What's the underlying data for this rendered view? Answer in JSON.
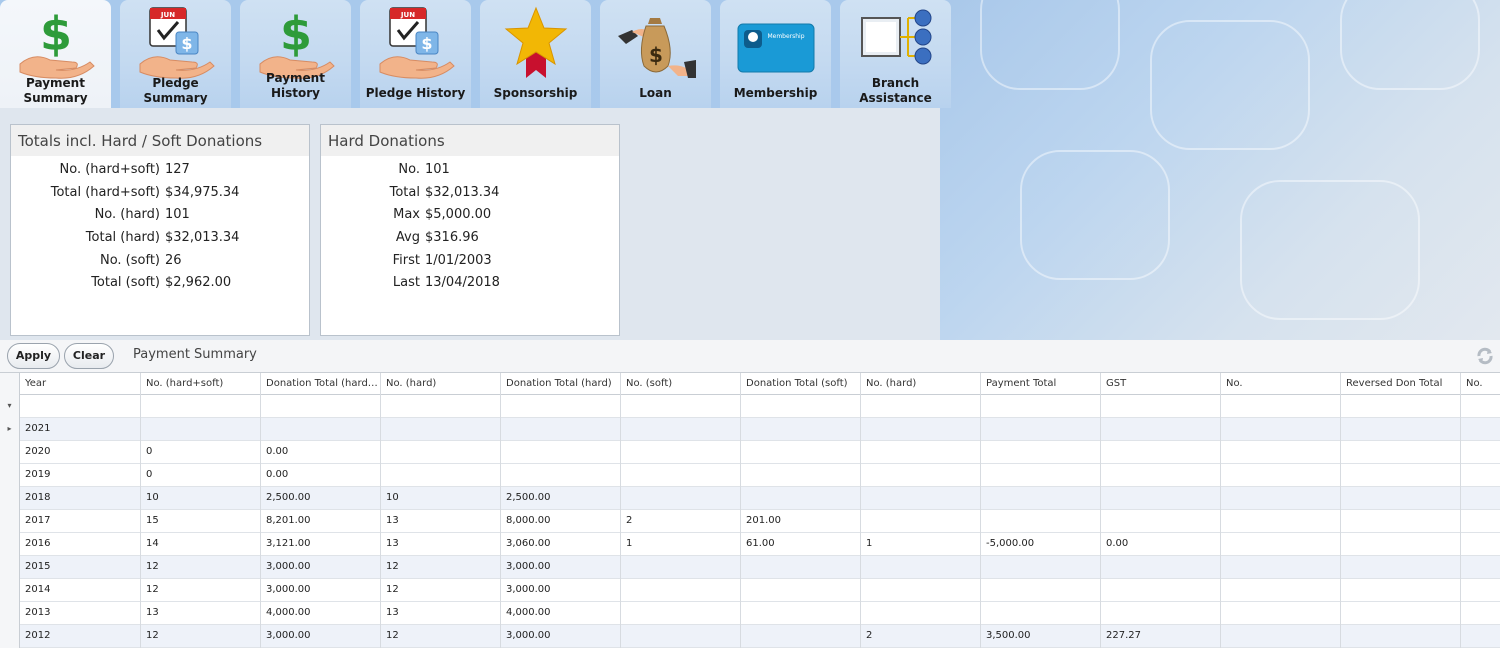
{
  "ribbon": {
    "tabs": [
      {
        "label": "Payment Summary",
        "icon": "payment-summary-icon",
        "active": true
      },
      {
        "label": "Pledge Summary",
        "icon": "pledge-summary-icon"
      },
      {
        "label": "Payment History",
        "icon": "payment-history-icon"
      },
      {
        "label": "Pledge History",
        "icon": "pledge-history-icon"
      },
      {
        "label": "Sponsorship",
        "icon": "sponsorship-star-icon"
      },
      {
        "label": "Loan",
        "icon": "loan-money-bag-icon"
      },
      {
        "label": "Membership",
        "icon": "membership-card-icon"
      },
      {
        "label": "Branch Assistance",
        "icon": "branch-assistance-icon"
      }
    ],
    "membership_card_text": "Membership"
  },
  "totals_panel": {
    "title": "Totals incl. Hard / Soft Donations",
    "rows": [
      {
        "label": "No. (hard+soft)",
        "value": "127"
      },
      {
        "label": "Total (hard+soft)",
        "value": "$34,975.34"
      },
      {
        "label": "No. (hard)",
        "value": "101"
      },
      {
        "label": "Total (hard)",
        "value": "$32,013.34"
      },
      {
        "label": "No. (soft)",
        "value": "26"
      },
      {
        "label": "Total (soft)",
        "value": "$2,962.00"
      }
    ]
  },
  "hard_panel": {
    "title": "Hard Donations",
    "rows": [
      {
        "label": "No.",
        "value": "101"
      },
      {
        "label": "Total",
        "value": "$32,013.34"
      },
      {
        "label": "Max",
        "value": "$5,000.00"
      },
      {
        "label": "Avg",
        "value": "$316.96"
      },
      {
        "label": "First",
        "value": "1/01/2003"
      },
      {
        "label": "Last",
        "value": "13/04/2018"
      }
    ]
  },
  "toolbar": {
    "apply_label": "Apply",
    "clear_label": "Clear",
    "title": "Payment Summary"
  },
  "grid": {
    "columns": [
      "Year",
      "No. (hard+soft)",
      "Donation Total (hard…",
      "No. (hard)",
      "Donation Total (hard)",
      "No. (soft)",
      "Donation Total (soft)",
      "No. (hard)",
      "Payment Total",
      "GST",
      "No.",
      "Reversed Don Total",
      "No."
    ],
    "rows": [
      [
        "2021",
        "",
        "",
        "",
        "",
        "",
        "",
        "",
        "",
        "",
        "",
        "",
        ""
      ],
      [
        "2020",
        "0",
        "0.00",
        "",
        "",
        "",
        "",
        "",
        "",
        "",
        "",
        "",
        ""
      ],
      [
        "2019",
        "0",
        "0.00",
        "",
        "",
        "",
        "",
        "",
        "",
        "",
        "",
        "",
        ""
      ],
      [
        "2018",
        "10",
        "2,500.00",
        "10",
        "2,500.00",
        "",
        "",
        "",
        "",
        "",
        "",
        "",
        ""
      ],
      [
        "2017",
        "15",
        "8,201.00",
        "13",
        "8,000.00",
        "2",
        "201.00",
        "",
        "",
        "",
        "",
        "",
        ""
      ],
      [
        "2016",
        "14",
        "3,121.00",
        "13",
        "3,060.00",
        "1",
        "61.00",
        "1",
        "-5,000.00",
        "0.00",
        "",
        "",
        ""
      ],
      [
        "2015",
        "12",
        "3,000.00",
        "12",
        "3,000.00",
        "",
        "",
        "",
        "",
        "",
        "",
        "",
        ""
      ],
      [
        "2014",
        "12",
        "3,000.00",
        "12",
        "3,000.00",
        "",
        "",
        "",
        "",
        "",
        "",
        "",
        ""
      ],
      [
        "2013",
        "13",
        "4,000.00",
        "13",
        "4,000.00",
        "",
        "",
        "",
        "",
        "",
        "",
        "",
        ""
      ],
      [
        "2012",
        "12",
        "3,000.00",
        "12",
        "3,000.00",
        "",
        "",
        "2",
        "3,500.00",
        "227.27",
        "",
        "",
        ""
      ]
    ]
  },
  "colors": {
    "ribbon_bg": "#a8c9ec",
    "tab_bg": "#c3d9f0",
    "active_tab_bg": "#eef2f7",
    "alt_row": "#eef2f9",
    "dollar_green": "#2e9b3a",
    "star_gold": "#f2b705",
    "ribbon_red": "#c8102e",
    "membership_blue": "#1a9ad6"
  }
}
